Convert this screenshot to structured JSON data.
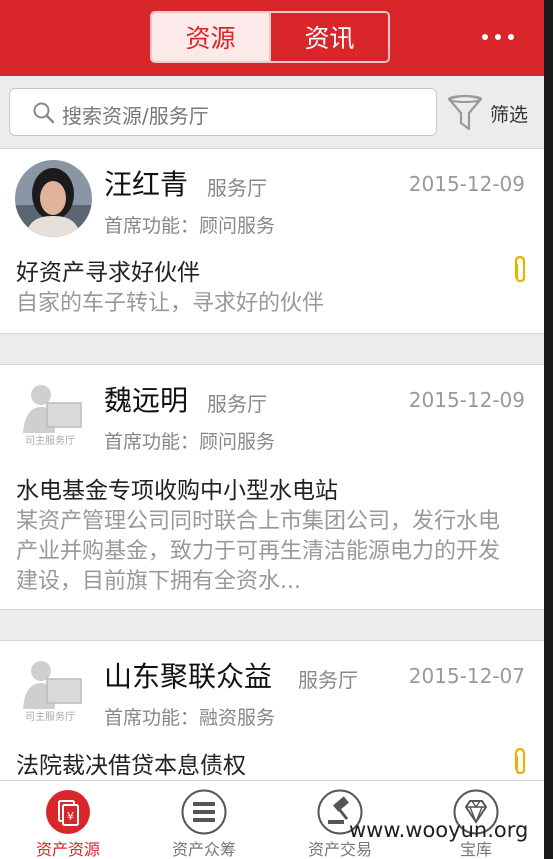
{
  "header": {
    "tabs": [
      {
        "label": "资源",
        "active": true
      },
      {
        "label": "资讯",
        "active": false
      }
    ]
  },
  "search": {
    "placeholder": "搜索资源/服务厅",
    "filter_label": "筛选"
  },
  "cards": [
    {
      "name": "汪红青",
      "tag": "服务厅",
      "date": "2015-12-09",
      "function": "首席功能：顾问服务",
      "title": "好资产寻求好伙伴",
      "description": "自家的车子转让，寻求好的伙伴",
      "has_attachment": true,
      "avatar": "photo"
    },
    {
      "name": "魏远明",
      "tag": "服务厅",
      "date": "2015-12-09",
      "function": "首席功能：顾问服务",
      "title": "水电基金专项收购中小型水电站",
      "description": "某资产管理公司同时联合上市集团公司，发行水电产业并购基金，致力于可再生清洁能源电力的开发建设，目前旗下拥有全资水...",
      "has_attachment": false,
      "avatar": "placeholder",
      "avatar_caption": "司主服务厅"
    },
    {
      "name": "山东聚联众益",
      "tag": "服务厅",
      "date": "2015-12-07",
      "function": "首席功能：融资服务",
      "title": "法院裁决借贷本息债权",
      "has_attachment": true,
      "avatar": "placeholder",
      "avatar_caption": "司主服务厅"
    }
  ],
  "bottom_nav": [
    {
      "label": "资产资源",
      "icon": "asset-resource-icon",
      "active": true
    },
    {
      "label": "资产众筹",
      "icon": "crowdfunding-icon",
      "active": false
    },
    {
      "label": "资产交易",
      "icon": "auction-gavel-icon",
      "active": false
    },
    {
      "label": "宝库",
      "icon": "diamond-icon",
      "active": false
    }
  ],
  "watermark": "www.wooyun.org",
  "colors": {
    "accent": "#d9262b",
    "attachment": "#e8b400"
  }
}
